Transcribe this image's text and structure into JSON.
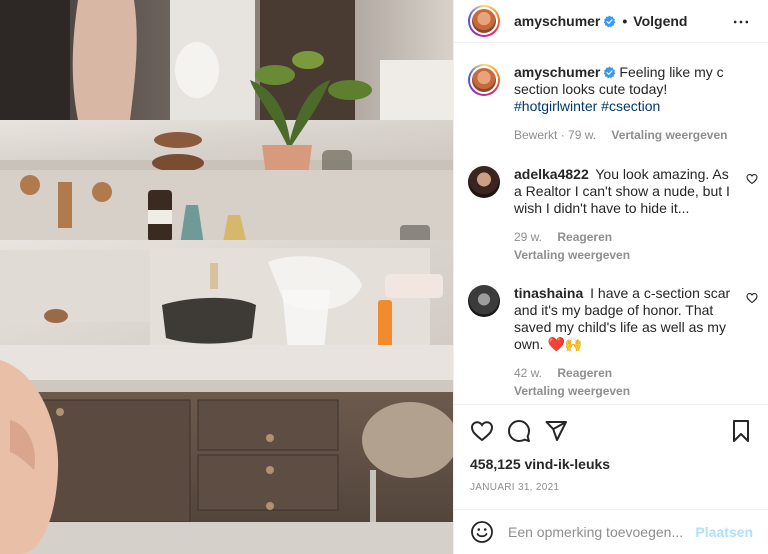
{
  "post": {
    "author": "amyschumer",
    "follow_label": "Volgend",
    "caption_text": "Feeling like my c section looks cute today!",
    "hashtags": [
      "#hotgirlwinter",
      "#csection"
    ],
    "caption_meta": {
      "edited": "Bewerkt",
      "separator": "·",
      "age": "79 w.",
      "translate": "Vertaling weergeven"
    },
    "likes": "458,125 vind-ik-leuks",
    "date": "JANUARI 31, 2021"
  },
  "comments": [
    {
      "username": "adelka4822",
      "text": "You look amazing. As a Realtor I can't show a nude, but I wish I didn't have to hide it...",
      "age": "29 w.",
      "reply": "Reageren",
      "translate": "Vertaling weergeven"
    },
    {
      "username": "tinashaina",
      "text": "I have a c-section scar and it's my badge of honor. That saved my child's life as well as my own. ❤️🙌",
      "age": "42 w.",
      "reply": "Reageren",
      "translate": "Vertaling weergeven"
    }
  ],
  "composer": {
    "placeholder": "Een opmerking toevoegen...",
    "post_label": "Plaatsen"
  },
  "icons": {
    "verified": "verified-badge-icon",
    "more": "more-options-icon",
    "like": "heart-icon",
    "comment": "comment-icon",
    "share": "paper-plane-icon",
    "save": "bookmark-icon",
    "emoji": "emoji-icon"
  },
  "colors": {
    "verified": "#3897f0",
    "link": "#00376b",
    "muted": "#8e8e8e",
    "post_button_disabled": "#b2dffc"
  }
}
